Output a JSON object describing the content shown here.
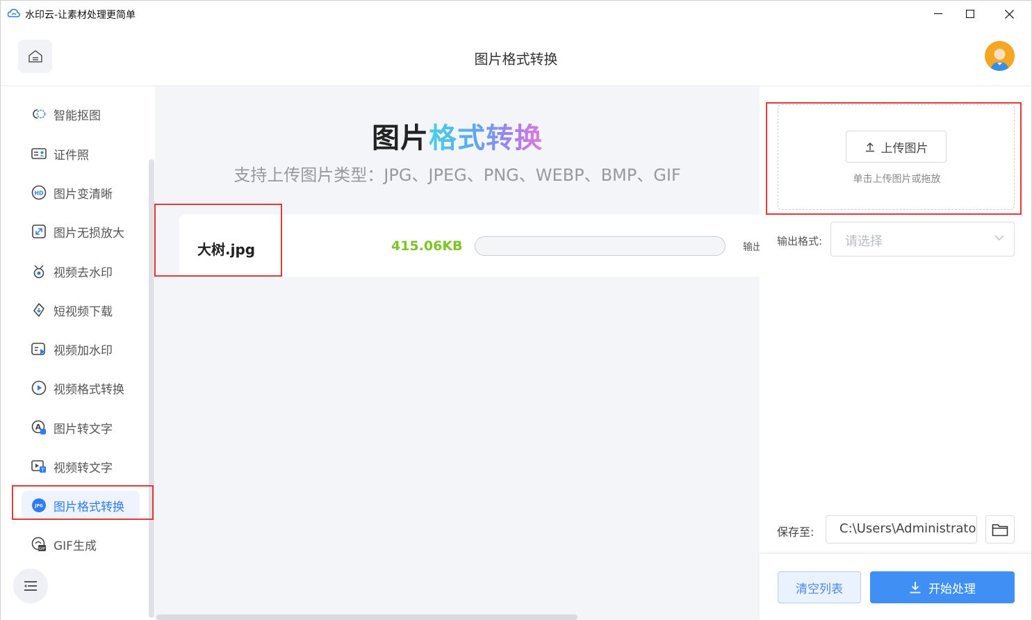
{
  "window": {
    "title": "水印云-让素材处理更简单"
  },
  "header": {
    "title": "图片格式转换"
  },
  "sidebar": {
    "items": [
      {
        "label": "智能抠图",
        "icon": "cutout-icon"
      },
      {
        "label": "证件照",
        "icon": "id-photo-icon"
      },
      {
        "label": "图片变清晰",
        "icon": "hd-icon"
      },
      {
        "label": "图片无损放大",
        "icon": "enlarge-icon"
      },
      {
        "label": "视频去水印",
        "icon": "video-remove-watermark-icon"
      },
      {
        "label": "短视频下载",
        "icon": "short-video-download-icon"
      },
      {
        "label": "视频加水印",
        "icon": "video-add-watermark-icon"
      },
      {
        "label": "视频格式转换",
        "icon": "video-format-icon"
      },
      {
        "label": "图片转文字",
        "icon": "image-to-text-icon"
      },
      {
        "label": "视频转文字",
        "icon": "video-to-text-icon"
      },
      {
        "label": "图片格式转换",
        "icon": "jpg-icon",
        "active": true
      },
      {
        "label": "GIF生成",
        "icon": "gif-icon"
      }
    ]
  },
  "main": {
    "hero_title_dark": "图片",
    "hero_title_colored": "格式转换",
    "hero_subtitle": "支持上传图片类型：JPG、JPEG、PNG、WEBP、BMP、GIF",
    "file": {
      "name": "大树.jpg",
      "size": "415.06KB",
      "progress": 0,
      "output_label_cut": "输出"
    }
  },
  "right_panel": {
    "upload_button": "上传图片",
    "upload_hint": "单击上传图片或拖放",
    "format_label": "输出格式:",
    "format_placeholder": "请选择",
    "save_label": "保存至:",
    "save_path": "C:\\Users\\Administrator",
    "clear_button": "清空列表",
    "start_button": "开始处理"
  },
  "colors": {
    "accent": "#3f8ff5",
    "highlight": "#e53935",
    "size_green": "#7cc523"
  }
}
